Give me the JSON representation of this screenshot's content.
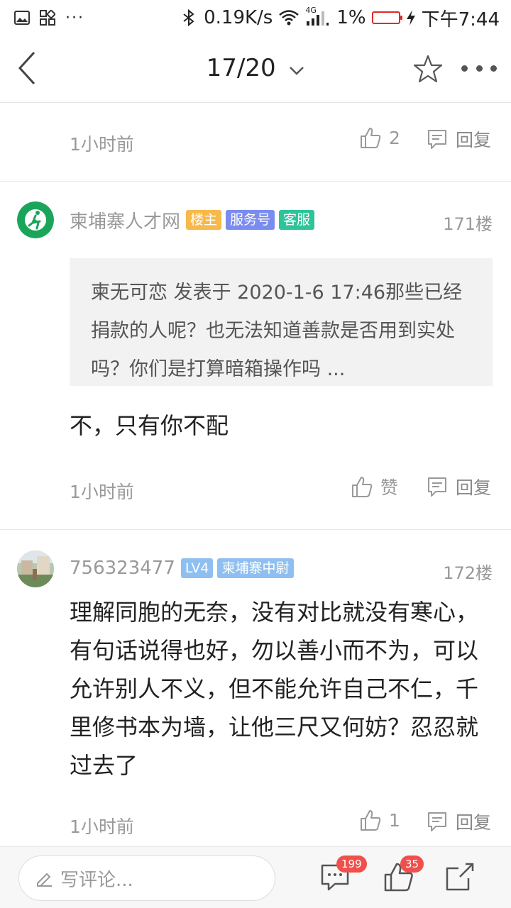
{
  "status_bar": {
    "network_speed": "0.19K/s",
    "network_type": "4G",
    "battery_percent": "1%",
    "time": "下午7:44",
    "battery_color": "#e02a2a"
  },
  "nav": {
    "page_indicator": "17/20"
  },
  "prev_post_footer": {
    "time": "1小时前",
    "like_count": "2",
    "reply_label": "回复"
  },
  "post_171": {
    "author": "柬埔寨人才网",
    "badges": [
      {
        "label": "楼主",
        "color": "#f6b94a"
      },
      {
        "label": "服务号",
        "color": "#7b8cf0"
      },
      {
        "label": "客服",
        "color": "#2dc49a"
      }
    ],
    "floor": "171楼",
    "quote": "柬无可恋 发表于 2020-1-6 17:46那些已经捐款的人呢？也无法知道善款是否用到实处吗？你们是打算暗箱操作吗 ...",
    "content": "不，只有你不配",
    "time": "1小时前",
    "like_label": "赞",
    "reply_label": "回复"
  },
  "post_172": {
    "author": "756323477",
    "badges": [
      {
        "label": "LV4",
        "color": "#8fbff0"
      },
      {
        "label": "柬埔寨中尉",
        "color": "#8fbff0"
      }
    ],
    "floor": "172楼",
    "content": "理解同胞的无奈，没有对比就没有寒心，有句话说得也好，勿以善小而不为，可以允许别人不义，但不能允许自己不仁，千里修书本为墙，让他三尺又何妨？忍忍就过去了",
    "time": "1小时前",
    "like_count": "1",
    "reply_label": "回复"
  },
  "bottom_bar": {
    "comment_placeholder": "写评论...",
    "comment_count": "199",
    "like_count": "35"
  }
}
